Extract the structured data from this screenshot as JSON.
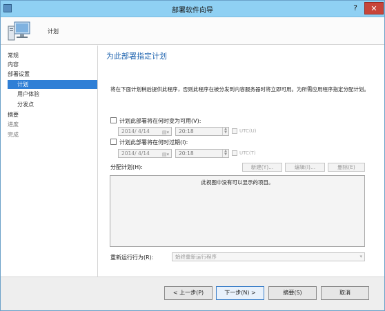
{
  "window": {
    "title": "部署软件向导",
    "help_label": "?",
    "close_label": "✕"
  },
  "header": {
    "title": "计划",
    "icon": "computer-icon"
  },
  "nav": {
    "items": [
      {
        "label": "常规"
      },
      {
        "label": "内容"
      },
      {
        "label": "部署设置"
      },
      {
        "label": "计划"
      },
      {
        "label": "用户体验"
      },
      {
        "label": "分发点"
      },
      {
        "label": "摘要"
      },
      {
        "label": "进度"
      },
      {
        "label": "完成"
      }
    ]
  },
  "main": {
    "heading": "为此部署指定计划",
    "description": "将在下面计划稍后提供此程序，否则此程序在被分发到内容服务器时将立即可用。为所需应用程序指定分配计划。",
    "available": {
      "label": "计划此部署将在何时变为可用(V):",
      "date": "2014/ 4/14",
      "time": "20:18",
      "utc_label": "UTC(U)"
    },
    "expire": {
      "label": "计划此部署将在何时过期(I):",
      "date": "2014/ 4/14",
      "time": "20:18",
      "utc_label": "UTC(T)"
    },
    "assignment": {
      "label": "分配计划(H):",
      "new_label": "新建(Y)...",
      "edit_label": "编辑(I)...",
      "delete_label": "删除(E)",
      "empty_text": "此视图中没有可以显示的项目。"
    },
    "rerun": {
      "label": "重新运行行为(R):",
      "value": "始终重新运行程序"
    }
  },
  "footer": {
    "prev_label": "< 上一步(P)",
    "next_label": "下一步(N) >",
    "summary_label": "摘要(S)",
    "cancel_label": "取消"
  },
  "colors": {
    "titlebar": "#8fd0f3",
    "accent": "#2f7fd6",
    "heading": "#2266b0"
  }
}
